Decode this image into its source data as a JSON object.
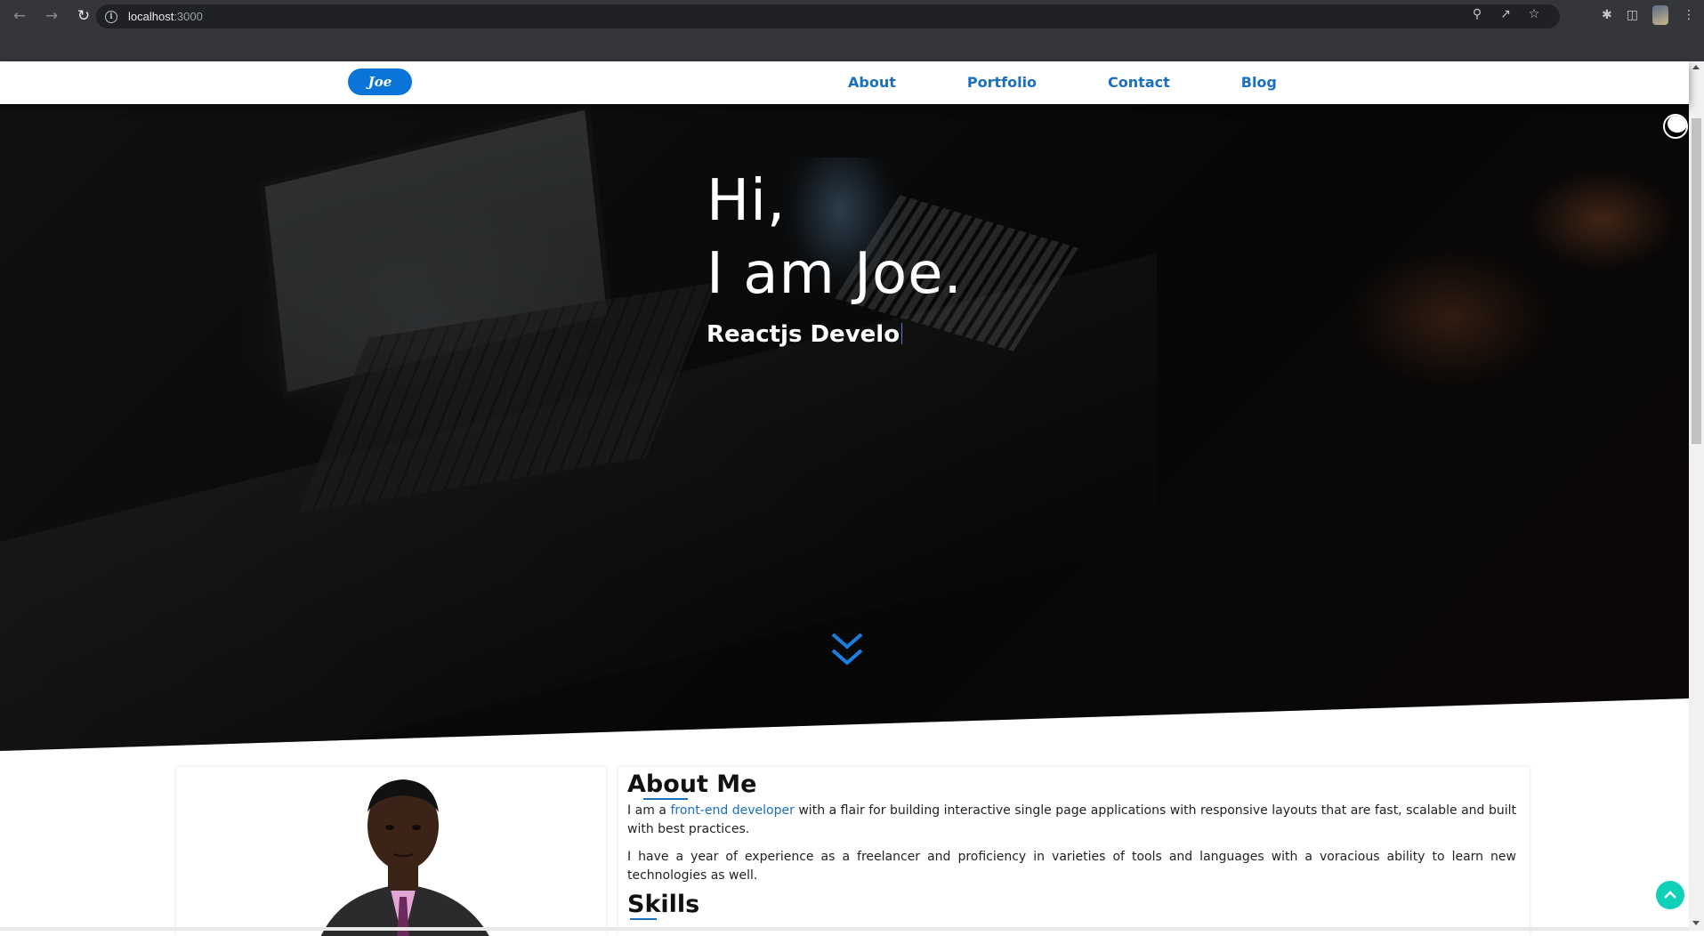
{
  "browser": {
    "url_host": "localhost",
    "url_port": ":3000",
    "icons": [
      "back-icon",
      "forward-icon",
      "reload-icon",
      "info-icon",
      "zoom-icon",
      "share-icon",
      "star-icon",
      "extensions-icon",
      "side-panel-icon",
      "profile-icon",
      "menu-icon"
    ]
  },
  "header": {
    "logo_text": "Joe",
    "nav": [
      {
        "label": "About"
      },
      {
        "label": "Portfolio"
      },
      {
        "label": "Contact"
      },
      {
        "label": "Blog"
      }
    ]
  },
  "hero": {
    "greeting_line1": "Hi,",
    "greeting_line2": "I am Joe.",
    "role_typed": "Reactjs Develo"
  },
  "about": {
    "title": "About Me",
    "p1_before": "I am a ",
    "p1_highlight": "front-end developer",
    "p1_after": " with a flair for building interactive single page applications with responsive layouts that are fast, scalable and built with best practices.",
    "p2": "I have a year of experience as a freelancer and proficiency in varieties of tools and languages with a voracious ability to learn new technologies as well.",
    "skills_title": "Skills"
  },
  "colors": {
    "accent": "#1a6fbf",
    "logo_bg": "#0b74d9",
    "scroll_top_bg": "#0fd0b8",
    "chrome_bg": "#35363a"
  }
}
